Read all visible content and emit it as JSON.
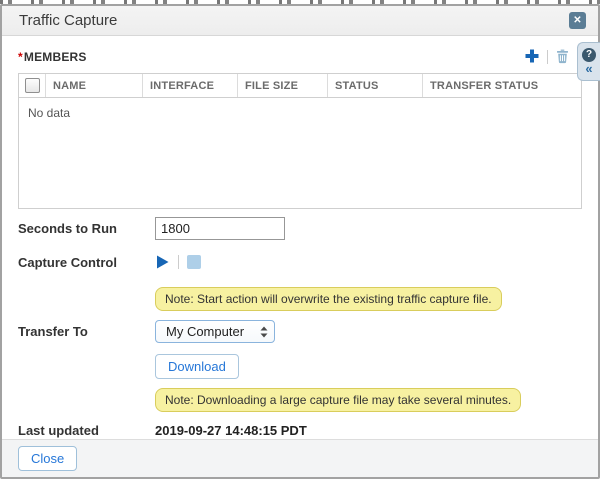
{
  "dialog": {
    "title": "Traffic Capture"
  },
  "members": {
    "required_marker": "*",
    "label": "MEMBERS",
    "table": {
      "columns": [
        "NAME",
        "INTERFACE",
        "FILE SIZE",
        "STATUS",
        "TRANSFER STATUS"
      ],
      "empty_text": "No data"
    }
  },
  "form": {
    "seconds_to_run": {
      "label": "Seconds to Run",
      "value": "1800"
    },
    "capture_control": {
      "label": "Capture Control",
      "note": "Note: Start action will overwrite the existing traffic capture file."
    },
    "transfer_to": {
      "label": "Transfer To",
      "selected_option": "My Computer",
      "download_label": "Download",
      "note": "Note: Downloading a large capture file may take several minutes."
    },
    "last_updated": {
      "label": "Last updated",
      "value": "2019-09-27 14:48:15 PDT"
    }
  },
  "footer": {
    "close_label": "Close"
  },
  "icons": {
    "window_close_glyph": "✕",
    "help_glyph": "?",
    "collapse_glyph": "«"
  },
  "colors": {
    "accent_blue": "#1766b5",
    "link_blue": "#2677d8",
    "trash_blue": "#8fb4cd",
    "note_bg": "#f7f1a1",
    "note_border": "#d9cd5c",
    "titlebar_bg": "#f0f0f0",
    "close_button_bg": "#5b7d95"
  }
}
